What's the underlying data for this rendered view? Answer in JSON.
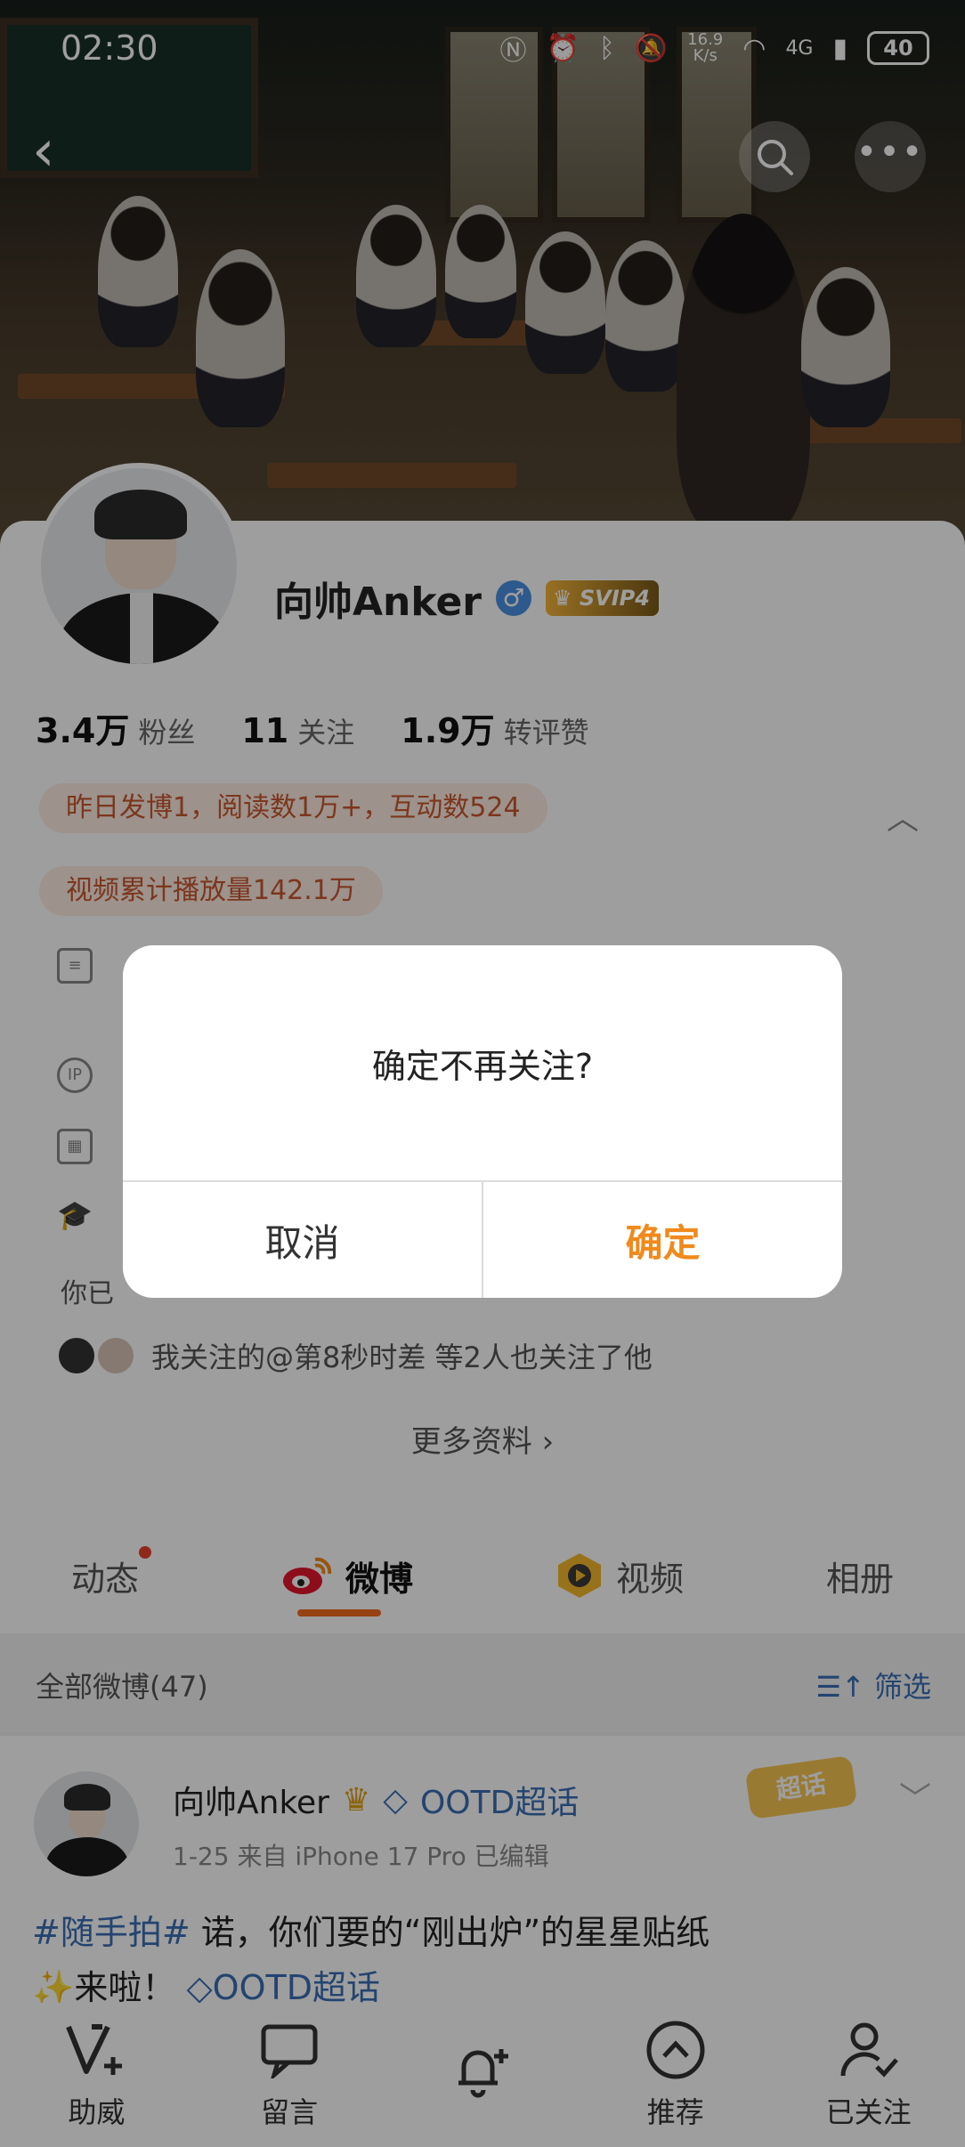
{
  "status_bar": {
    "time": "02:30",
    "net_speed_value": "16.9",
    "net_speed_unit": "K/s",
    "network": "4G",
    "battery": "40"
  },
  "profile": {
    "name": "向帅Anker",
    "gender_icon": "♂",
    "vip_badge": "SVIP4",
    "stats": [
      {
        "num": "3.4万",
        "label": "粉丝"
      },
      {
        "num": "11",
        "label": "关注"
      },
      {
        "num": "1.9万",
        "label": "转评赞"
      }
    ],
    "tags": [
      "昨日发博1，阅读数1万+，互动数524",
      "视频累计播放量142.1万"
    ],
    "info_partial": [
      "",
      "",
      "",
      "",
      "你已"
    ],
    "mutual": "我关注的@第8秒时差 等2人也关注了他",
    "more_info": "更多资料 ›"
  },
  "tabs": [
    {
      "label": "动态",
      "icon": "",
      "has_dot": true
    },
    {
      "label": "微博",
      "icon": "weibo-logo-icon",
      "active": true
    },
    {
      "label": "视频",
      "icon": "video-play-icon"
    },
    {
      "label": "相册",
      "icon": ""
    }
  ],
  "filter_bar": {
    "all_label": "全部微博(47)",
    "filter_label": "筛选"
  },
  "post": {
    "author": "向帅Anker",
    "topic": "OOTD超话",
    "chaohua_badge": "超话",
    "meta": "1-25  来自 iPhone 17 Pro  已编辑",
    "text_hashtag": "#随手拍#",
    "text_body": " 诺，你们要的“刚出炉”的星星贴纸",
    "text_line2": "来啦！",
    "text_topic": "OOTD超话"
  },
  "dialog": {
    "message": "确定不再关注?",
    "cancel_label": "取消",
    "confirm_label": "确定"
  },
  "toolbar": [
    {
      "label": "助威",
      "icon": "cheer-v-icon"
    },
    {
      "label": "留言",
      "icon": "message-icon"
    },
    {
      "label": "",
      "icon": "bell-plus-icon"
    },
    {
      "label": "推荐",
      "icon": "recommend-chevron-icon"
    },
    {
      "label": "已关注",
      "icon": "user-check-icon"
    }
  ],
  "colors": {
    "accent_orange": "#f08a1d",
    "link_blue": "#3b6fb5",
    "tag_bg": "#fdece3",
    "tag_text": "#c9582f"
  }
}
